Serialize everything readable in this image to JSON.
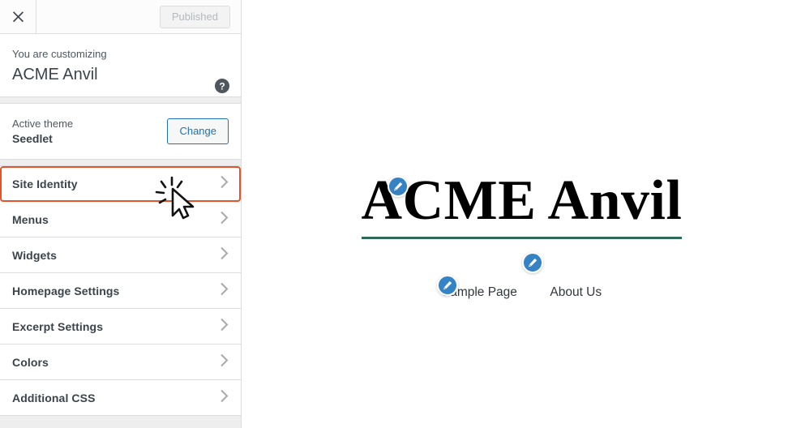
{
  "topbar": {
    "close_icon": "close-icon",
    "publish_label": "Published"
  },
  "info": {
    "kicker": "You are customizing",
    "site_name": "ACME Anvil",
    "help_icon": "help-icon"
  },
  "theme": {
    "kicker": "Active theme",
    "name": "Seedlet",
    "change_label": "Change"
  },
  "panels": [
    {
      "label": "Site Identity",
      "focused": true
    },
    {
      "label": "Menus",
      "focused": false
    },
    {
      "label": "Widgets",
      "focused": false
    },
    {
      "label": "Homepage Settings",
      "focused": false
    },
    {
      "label": "Excerpt Settings",
      "focused": false
    },
    {
      "label": "Colors",
      "focused": false
    },
    {
      "label": "Additional CSS",
      "focused": false
    }
  ],
  "preview": {
    "site_title": "ACME Anvil",
    "nav": [
      {
        "label": "Sample Page"
      },
      {
        "label": "About Us"
      }
    ],
    "shortcuts": [
      {
        "name": "edit-site-title-shortcut"
      },
      {
        "name": "edit-menu-shortcut"
      },
      {
        "name": "edit-page-shortcut"
      }
    ]
  },
  "colors": {
    "accent_blue": "#3582c4",
    "link_blue": "#2271b1",
    "focus_orange": "#e8522a",
    "title_underline_green": "#2e6b54",
    "sidebar_bg": "#eeeeee",
    "text_dark": "#3c434a"
  }
}
